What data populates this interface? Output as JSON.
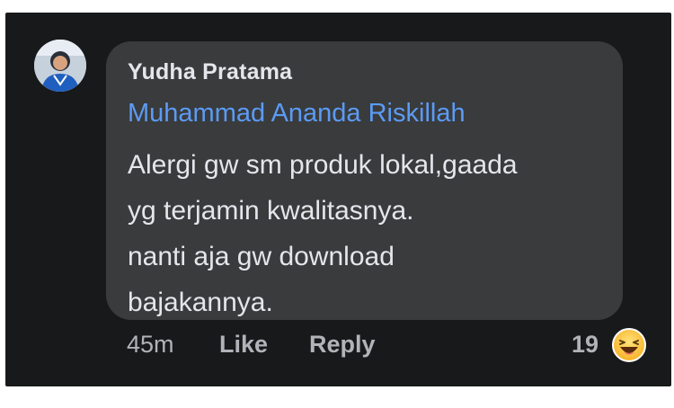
{
  "comment": {
    "author_name": "Yudha Pratama",
    "mention": "Muhammad Ananda Riskillah",
    "text_lines": [
      "Alergi gw sm produk lokal,gaada",
      "yg terjamin kwalitasnya.",
      "nanti aja gw download",
      "bajakannya."
    ]
  },
  "actions": {
    "timestamp": "45m",
    "like_label": "Like",
    "reply_label": "Reply"
  },
  "reactions": {
    "count": "19",
    "icon": "haha-emoji-icon"
  },
  "colors": {
    "background": "#18191a",
    "bubble": "#3a3b3c",
    "mention": "#5b9bf5",
    "text": "#e4e6eb",
    "meta": "#b0b3b8"
  }
}
